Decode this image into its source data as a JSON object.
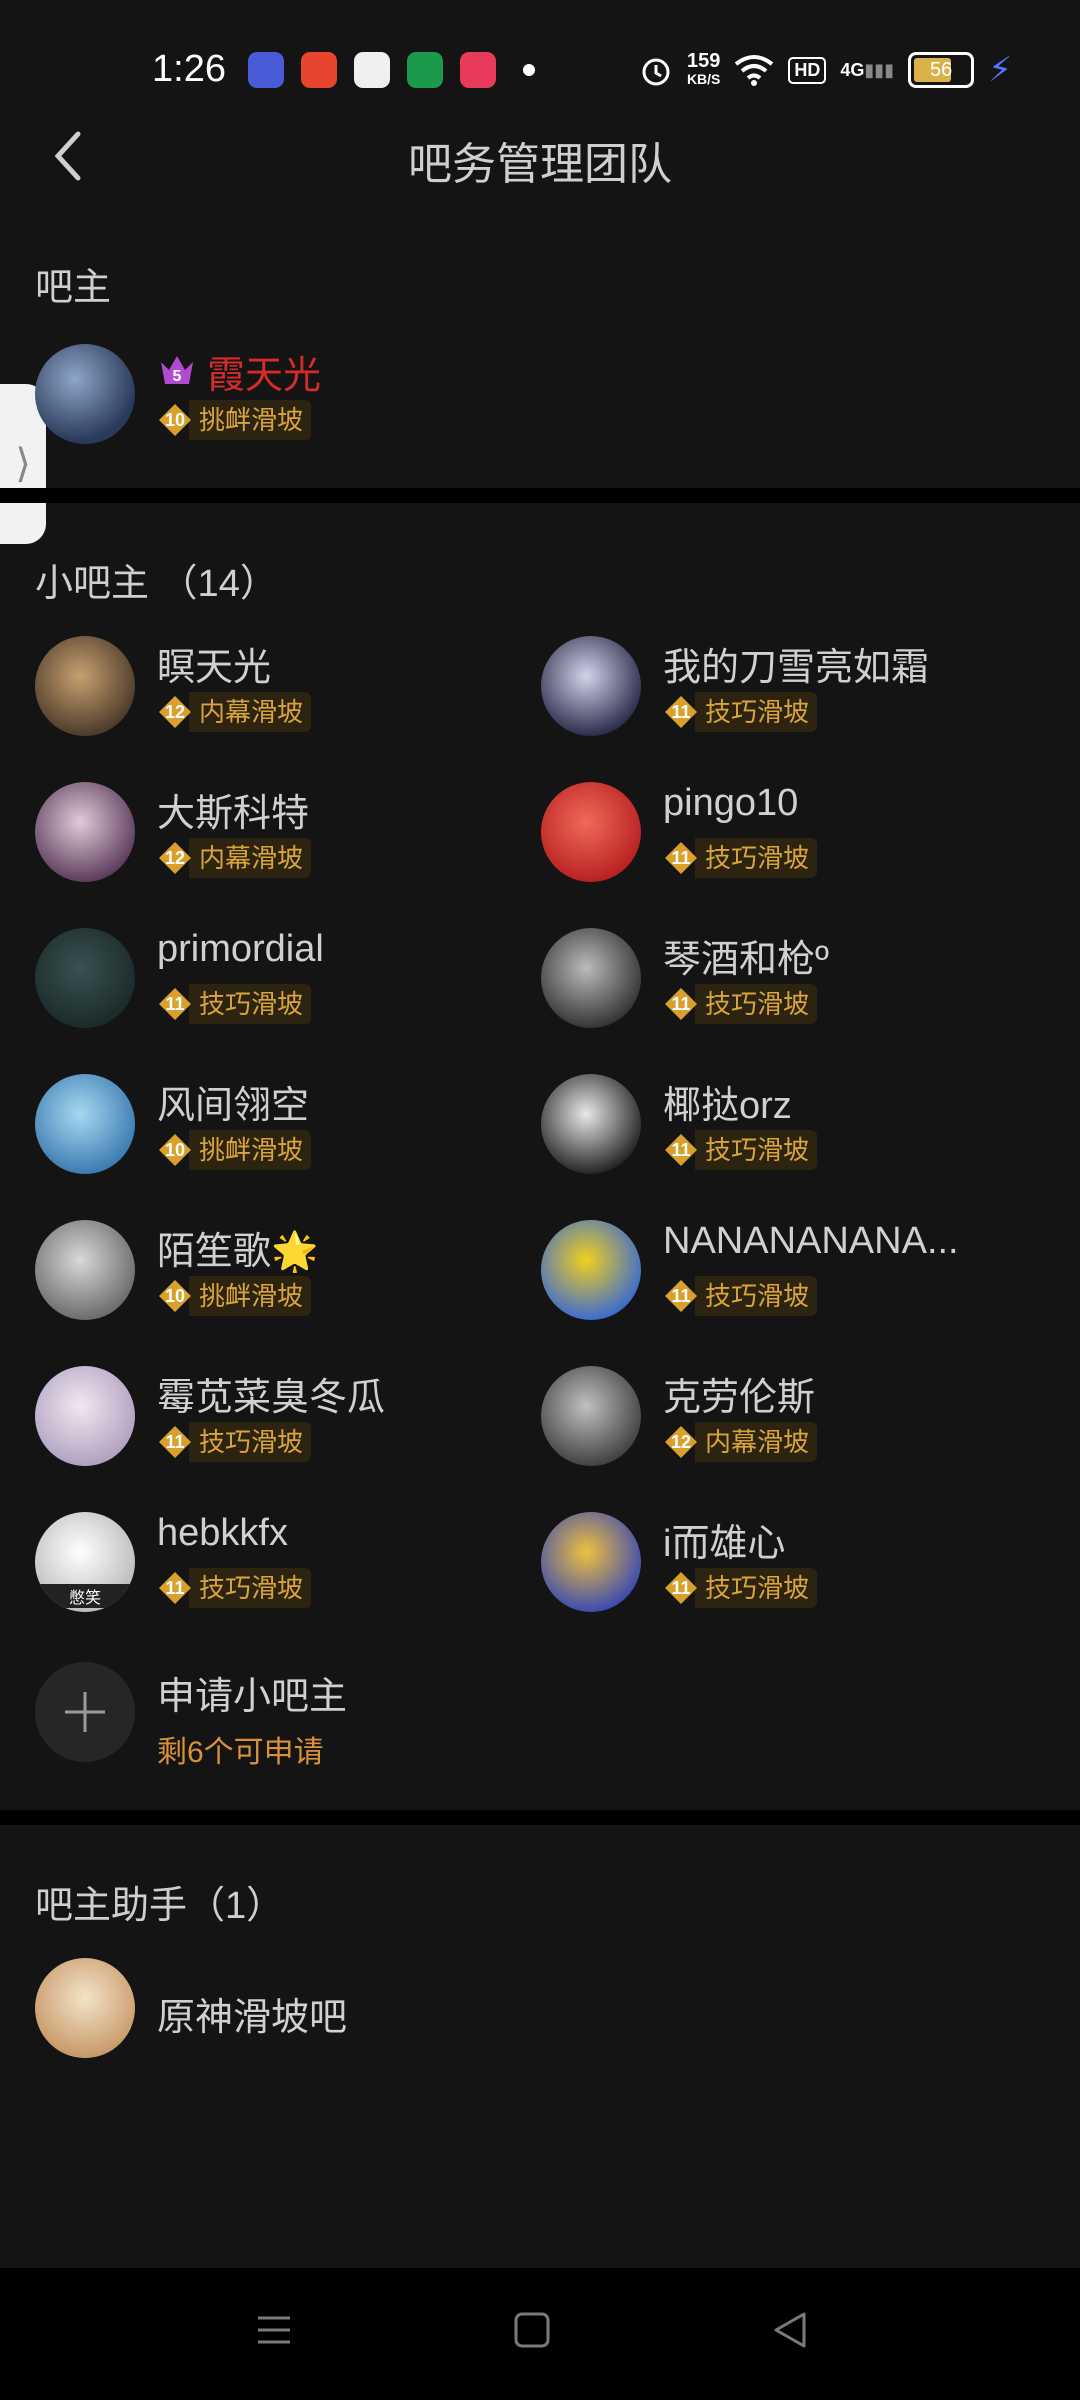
{
  "status_bar": {
    "time": "1:26",
    "net_speed": "159",
    "net_unit": "KB/S",
    "hd": "HD",
    "signal": "4G",
    "battery": "56"
  },
  "header": {
    "title": "吧务管理团队"
  },
  "owner_section": {
    "title": "吧主",
    "member": {
      "name": "霞天光",
      "level": "10",
      "title": "挑衅滑坡",
      "crown_level": "5"
    }
  },
  "sub_section": {
    "title": "小吧主 （14）",
    "members": [
      {
        "name": "瞑天光",
        "level": "12",
        "title": "内幕滑坡"
      },
      {
        "name": "我的刀雪亮如霜",
        "level": "11",
        "title": "技巧滑坡"
      },
      {
        "name": "大斯科特",
        "level": "12",
        "title": "内幕滑坡"
      },
      {
        "name": "pingo10",
        "level": "11",
        "title": "技巧滑坡"
      },
      {
        "name": "primordial",
        "level": "11",
        "title": "技巧滑坡"
      },
      {
        "name": "琴酒和枪º",
        "level": "11",
        "title": "技巧滑坡"
      },
      {
        "name": "风间翎空",
        "level": "10",
        "title": "挑衅滑坡"
      },
      {
        "name": "椰挞orz",
        "level": "11",
        "title": "技巧滑坡"
      },
      {
        "name": "陌笙歌🌟",
        "level": "10",
        "title": "挑衅滑坡"
      },
      {
        "name": "NANANANANA...",
        "level": "11",
        "title": "技巧滑坡"
      },
      {
        "name": "霉苋菜臭冬瓜",
        "level": "11",
        "title": "技巧滑坡"
      },
      {
        "name": "克劳伦斯",
        "level": "12",
        "title": "内幕滑坡"
      },
      {
        "name": "hebkkfx",
        "level": "11",
        "title": "技巧滑坡"
      },
      {
        "name": "i而雄心",
        "level": "11",
        "title": "技巧滑坡"
      }
    ],
    "apply": {
      "label": "申请小吧主",
      "remaining": "剩6个可申请"
    },
    "hebkkfx_avatar_text": "憋笑"
  },
  "assistant_section": {
    "title": "吧主助手（1）",
    "member": {
      "name": "原神滑坡吧"
    }
  },
  "colors": {
    "background": "#141414",
    "owner_name": "#d62b2b",
    "badge_text": "#d9a43b",
    "apply_sub": "#d9923b"
  }
}
